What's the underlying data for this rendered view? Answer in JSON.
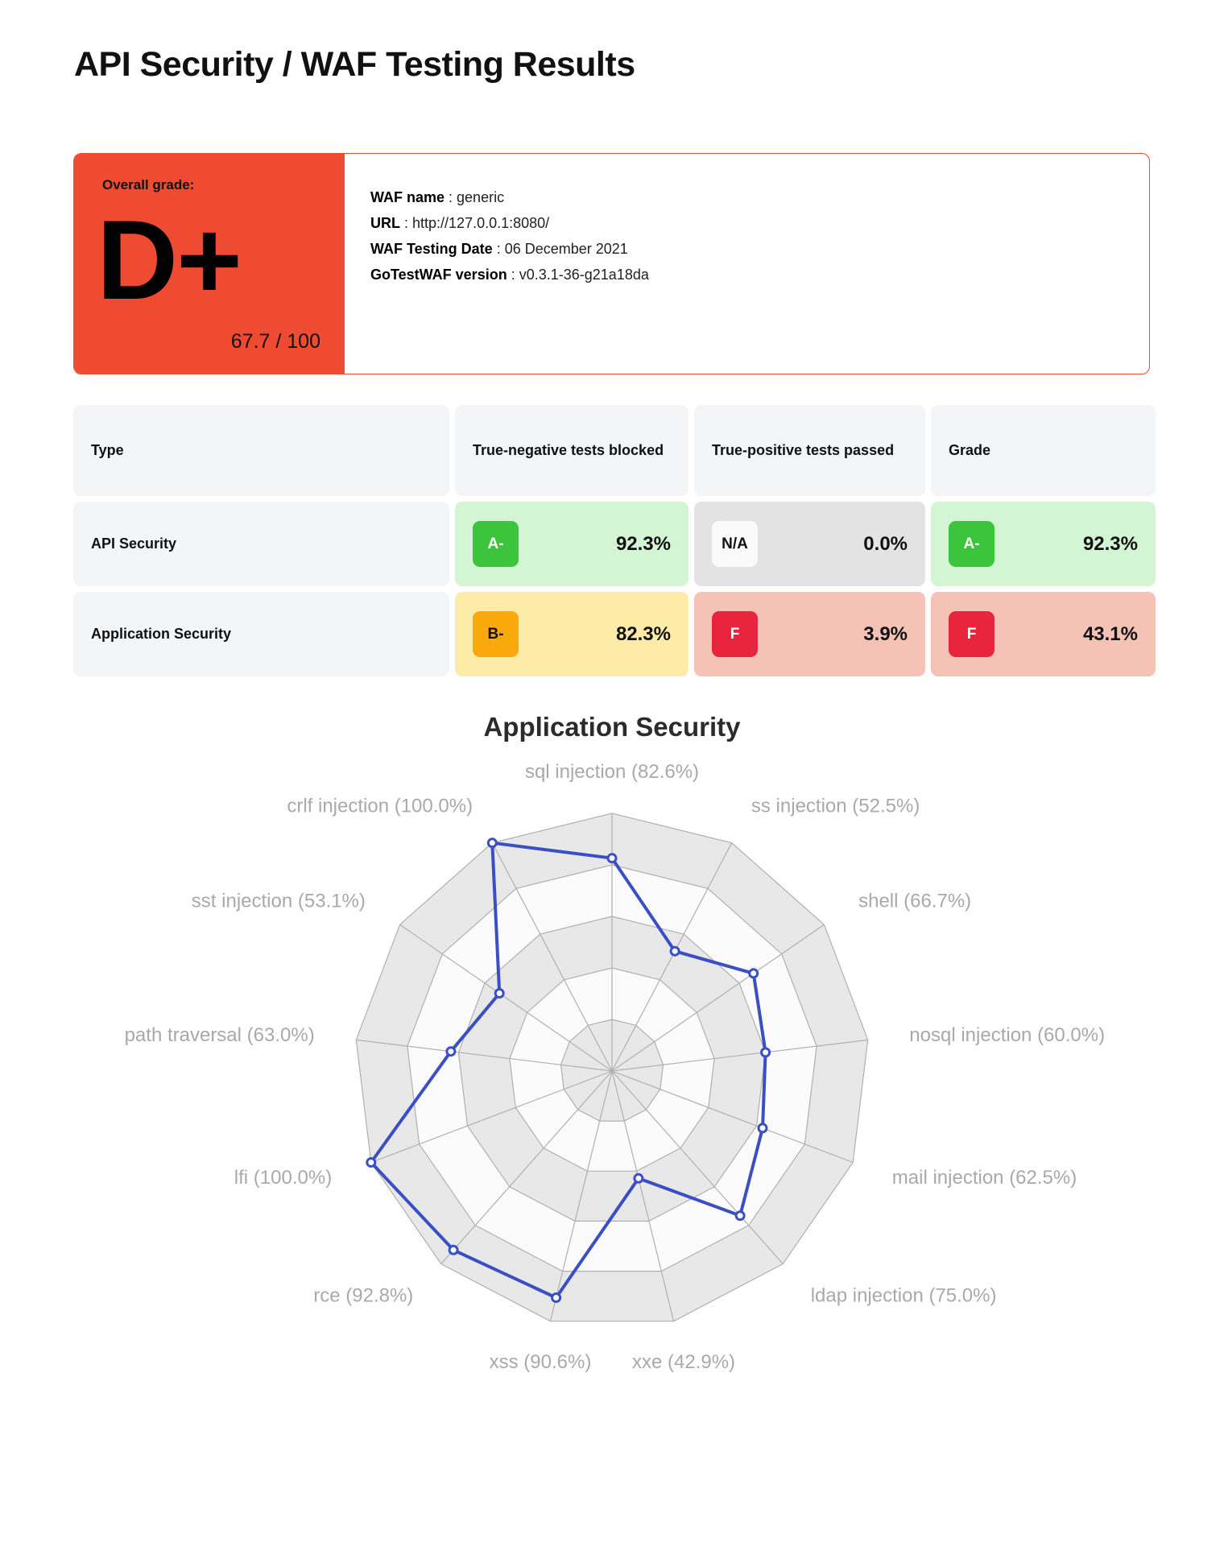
{
  "page_title": "API Security / WAF Testing Results",
  "grade_card": {
    "overall_grade_label": "Overall grade:",
    "grade": "D+",
    "score": "67.7 / 100",
    "accent_color": "#ef4a32",
    "info": [
      {
        "key": "WAF name",
        "sep": " : ",
        "value": "generic"
      },
      {
        "key": "URL",
        "sep": " : ",
        "value": "http://127.0.0.1:8080/"
      },
      {
        "key": "WAF Testing Date",
        "sep": " : ",
        "value": "06 December 2021"
      },
      {
        "key": "GoTestWAF version",
        "sep": " : ",
        "value": "v0.3.1-36-g21a18da"
      }
    ]
  },
  "results_table": {
    "headers": {
      "type": "Type",
      "true_negative": "True-negative tests blocked",
      "true_positive": "True-positive tests passed",
      "grade": "Grade"
    },
    "rows": [
      {
        "type": "API Security",
        "tn_badge": "A-",
        "tn_pct": "92.3%",
        "tp_badge": "N/A",
        "tp_pct": "0.0%",
        "grade_badge": "A-",
        "grade_pct": "92.3%"
      },
      {
        "type": "Application Security",
        "tn_badge": "B-",
        "tn_pct": "82.3%",
        "tp_badge": "F",
        "tp_pct": "3.9%",
        "grade_badge": "F",
        "grade_pct": "43.1%"
      }
    ]
  },
  "chart_data": {
    "type": "radar",
    "title": "Application Security",
    "ylim": [
      0,
      100
    ],
    "rings": [
      20,
      40,
      60,
      80,
      100
    ],
    "grid": true,
    "legend": "none",
    "line_color": "#3a4fc4",
    "marker_color": "#ffffff",
    "categories": [
      "sql injection",
      "ss injection",
      "shell",
      "nosql injection",
      "mail injection",
      "ldap injection",
      "xxe",
      "xss",
      "rce",
      "lfi",
      "path traversal",
      "sst injection",
      "crlf injection"
    ],
    "values": [
      82.6,
      52.5,
      66.7,
      60.0,
      62.5,
      75.0,
      42.9,
      90.6,
      92.8,
      100.0,
      63.0,
      53.1,
      100.0
    ],
    "tick_labels": [
      "sql injection (82.6%)",
      "ss injection (52.5%)",
      "shell (66.7%)",
      "nosql injection (60.0%)",
      "mail injection (62.5%)",
      "ldap injection (75.0%)",
      "xxe (42.9%)",
      "xss (90.6%)",
      "rce (92.8%)",
      "lfi (100.0%)",
      "path traversal (63.0%)",
      "sst injection (53.1%)",
      "crlf injection (100.0%)"
    ]
  }
}
